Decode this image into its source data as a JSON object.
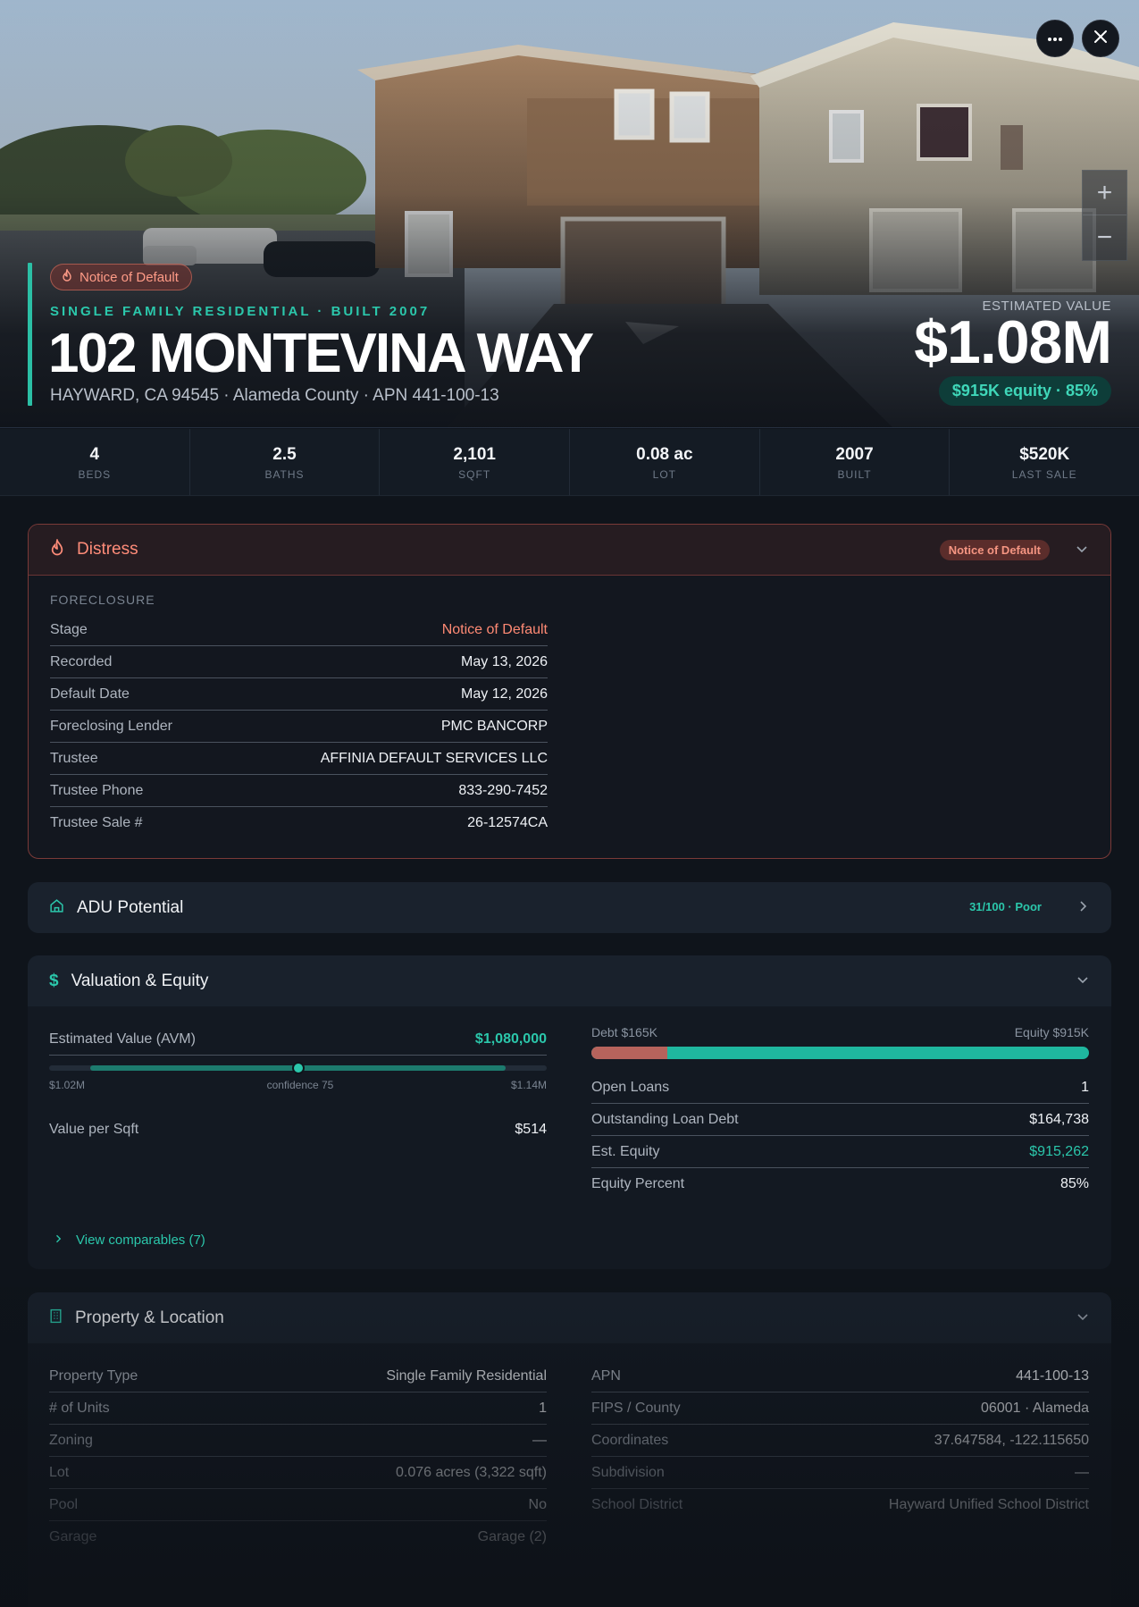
{
  "hero": {
    "badge": "Notice of Default",
    "subtitle": "SINGLE FAMILY RESIDENTIAL · BUILT 2007",
    "title": "102 MONTEVINA WAY",
    "address_line": "HAYWARD, CA 94545 · Alameda County · APN 441-100-13",
    "estimated_value_label": "ESTIMATED VALUE",
    "estimated_value": "$1.08M",
    "equity_pill": "$915K equity · 85%",
    "zoom_in": "+",
    "zoom_out": "−"
  },
  "stats": [
    {
      "value": "4",
      "label": "BEDS"
    },
    {
      "value": "2.5",
      "label": "BATHS"
    },
    {
      "value": "2,101",
      "label": "SQFT"
    },
    {
      "value": "0.08 ac",
      "label": "LOT"
    },
    {
      "value": "2007",
      "label": "BUILT"
    },
    {
      "value": "$520K",
      "label": "LAST SALE"
    }
  ],
  "distress": {
    "title": "Distress",
    "badge": "Notice of Default",
    "section": "FORECLOSURE",
    "rows": [
      {
        "k": "Stage",
        "v": "Notice of Default"
      },
      {
        "k": "Recorded",
        "v": "May 13, 2026"
      },
      {
        "k": "Default Date",
        "v": "May 12, 2026"
      },
      {
        "k": "Foreclosing Lender",
        "v": "PMC BANCORP"
      },
      {
        "k": "Trustee",
        "v": "AFFINIA DEFAULT SERVICES LLC"
      },
      {
        "k": "Trustee Phone",
        "v": "833-290-7452"
      },
      {
        "k": "Trustee Sale #",
        "v": "26-12574CA"
      }
    ]
  },
  "adu": {
    "title": "ADU Potential",
    "score": "31/100 · Poor"
  },
  "valuation": {
    "title": "Valuation & Equity",
    "avm_label": "Estimated Value (AVM)",
    "avm_value": "$1,080,000",
    "range_low": "$1.02M",
    "range_confidence": "confidence 75",
    "range_high": "$1.14M",
    "value_per_sqft_label": "Value per Sqft",
    "value_per_sqft": "$514",
    "debt_label": "Debt $165K",
    "equity_label": "Equity $915K",
    "debt_fraction": 0.153,
    "rows": [
      {
        "k": "Open Loans",
        "v": "1"
      },
      {
        "k": "Outstanding Loan Debt",
        "v": "$164,738"
      },
      {
        "k": "Est. Equity",
        "v": "$915,262"
      },
      {
        "k": "Equity Percent",
        "v": "85%"
      }
    ],
    "comparables_link": "View comparables (7)"
  },
  "property": {
    "title": "Property & Location",
    "left_rows": [
      {
        "k": "Property Type",
        "v": "Single Family Residential"
      },
      {
        "k": "# of Units",
        "v": "1"
      },
      {
        "k": "Zoning",
        "v": "—"
      },
      {
        "k": "Lot",
        "v": "0.076 acres (3,322 sqft)"
      },
      {
        "k": "Pool",
        "v": "No"
      },
      {
        "k": "Garage",
        "v": "Garage (2)"
      }
    ],
    "right_rows": [
      {
        "k": "APN",
        "v": "441-100-13"
      },
      {
        "k": "FIPS / County",
        "v": "06001 · Alameda"
      },
      {
        "k": "Coordinates",
        "v": "37.647584, -122.115650"
      },
      {
        "k": "Subdivision",
        "v": "—"
      },
      {
        "k": "School District",
        "v": "Hayward Unified School District"
      }
    ]
  },
  "colors": {
    "accent_teal": "#2bc7ab",
    "distress_red": "#ff8a74",
    "debt_bar": "#b6635c"
  }
}
